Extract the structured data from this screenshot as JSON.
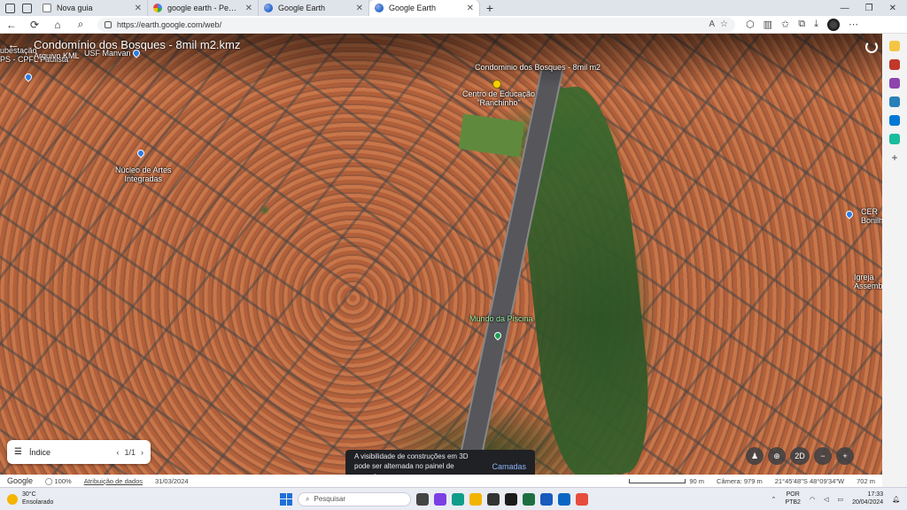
{
  "browser": {
    "tabs": [
      {
        "title": "Nova guia",
        "favicon": "page-icon",
        "active": false
      },
      {
        "title": "google earth - Pesquisar",
        "favicon": "google-icon",
        "active": false
      },
      {
        "title": "Google Earth",
        "favicon": "earth-icon",
        "active": false
      },
      {
        "title": "Google Earth",
        "favicon": "earth-icon",
        "active": true
      }
    ],
    "url": "https://earth.google.com/web/"
  },
  "earth": {
    "document_title": "Condomínio dos Bosques - 8mil m2.kmz",
    "document_subtitle": "Arquivo KML",
    "map_labels": {
      "condominio": "Condominio dos Bosques - 8mil m2",
      "centro_educacao": "Centro de Educação\n\"Ranchinho\"",
      "nucleo_artes": "Núcleo de Artes\nIntegradas",
      "mundo_piscina": "Mundo da Piscina",
      "cer": "CER\nBonilh",
      "igreja": "Igreja\nAssemb",
      "usf": "USF Manvan",
      "top_left_a": "ubestação",
      "top_left_b": "PS - CPFL Paulista"
    },
    "index": {
      "label": "Índice",
      "page": "1/1"
    },
    "toast": {
      "message": "A visibilidade de construções em 3D pode ser alternada no painel de camadas.",
      "action": "Camadas"
    },
    "controls": {
      "mode_label": "2D"
    },
    "status": {
      "brand": "Google",
      "zoom": "100%",
      "attribution": "Atribuição de dados",
      "date": "31/03/2024",
      "scale": "90 m",
      "camera": "Câmera: 979 m",
      "coords": "21°45'48\"S 48°09'34\"W",
      "elevation": "702 m"
    }
  },
  "taskbar": {
    "weather_temp": "30°C",
    "weather_desc": "Ensolarado",
    "search_placeholder": "Pesquisar",
    "lang_top": "POR",
    "lang_bottom": "PTB2",
    "time": "17:33",
    "date": "20/04/2024"
  },
  "colors": {
    "accent": "#1a73e8",
    "toast_action": "#8ab4f8",
    "pushpin": "#f5d000"
  }
}
